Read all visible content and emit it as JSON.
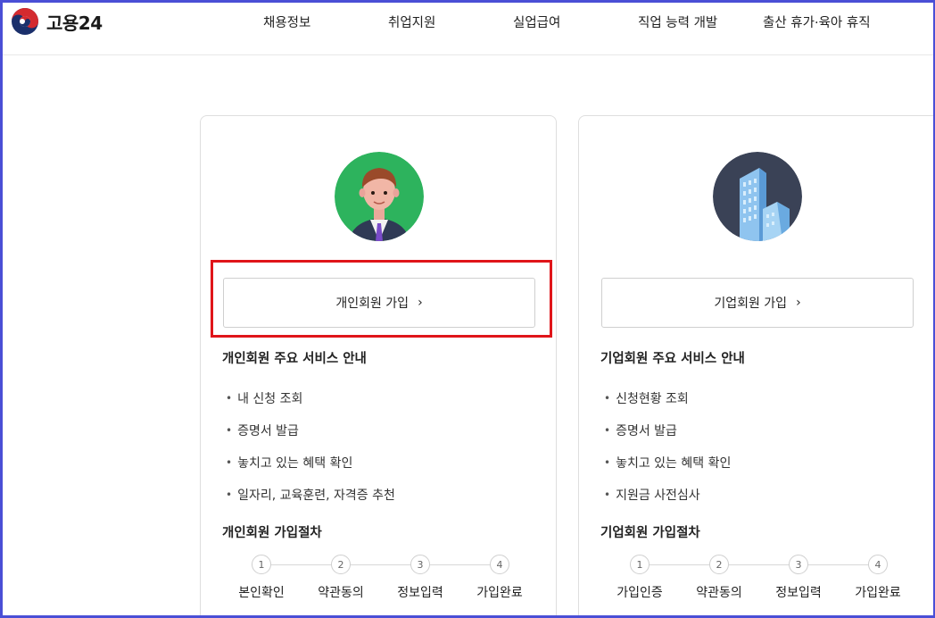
{
  "header": {
    "logo_text": "고용24",
    "nav": [
      "채용정보",
      "취업지원",
      "실업급여",
      "직업 능력 개발",
      "출산 휴가·육아 휴직"
    ]
  },
  "personal": {
    "join_button": "개인회원 가입",
    "services_title": "개인회원 주요 서비스 안내",
    "services": [
      "내 신청 조회",
      "증명서 발급",
      "놓치고 있는 혜택 확인",
      "일자리, 교육훈련, 자격증 추천"
    ],
    "steps_title": "개인회원 가입절차",
    "steps": [
      {
        "num": "1",
        "label": "본인확인"
      },
      {
        "num": "2",
        "label": "약관동의"
      },
      {
        "num": "3",
        "label": "정보입력"
      },
      {
        "num": "4",
        "label": "가입완료"
      }
    ]
  },
  "business": {
    "join_button": "기업회원 가입",
    "services_title": "기업회원 주요 서비스 안내",
    "services": [
      "신청현황 조회",
      "증명서 발급",
      "놓치고 있는 혜택 확인",
      "지원금 사전심사"
    ],
    "steps_title": "기업회원 가입절차",
    "steps": [
      {
        "num": "1",
        "label": "가입인증"
      },
      {
        "num": "2",
        "label": "약관동의"
      },
      {
        "num": "3",
        "label": "정보입력"
      },
      {
        "num": "4",
        "label": "가입완료"
      }
    ]
  },
  "icons": {
    "chevron": "chevron-right-icon",
    "person": "person-avatar-icon",
    "building": "building-icon"
  },
  "colors": {
    "highlight": "#e0151a",
    "avatar_bg": "#2db35d",
    "building_bg": "#3a4256",
    "frame": "#4a4fd6"
  }
}
